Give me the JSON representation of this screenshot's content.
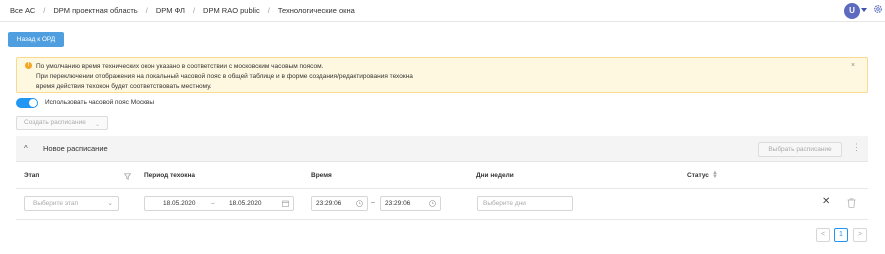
{
  "breadcrumb": {
    "items": [
      "Все АС",
      "DPM проектная область",
      "DPM ФЛ",
      "DPM RAO public",
      "Технологические окна"
    ],
    "separator": "/"
  },
  "user": {
    "avatar_letter": "U"
  },
  "back_button": {
    "label": "Назад к ОРД"
  },
  "alert": {
    "line1": "По умолчанию время технических окон указано в соответствии с московским часовым поясом.",
    "line2": "При переключении отображения на локальный часовой пояс в общей таблице и в форме создания/редактирования техокна",
    "line3": "время действия техокон будет соответствовать местному.",
    "close": "×"
  },
  "timezone_toggle": {
    "label": "Использовать часовой пояс Москвы",
    "enabled": true
  },
  "create_schedule": {
    "label": "Создать расписание"
  },
  "panel": {
    "title": "Новое расписание",
    "choose_button": "Выбрать расписание"
  },
  "table": {
    "headers": {
      "stage": "Этап",
      "period": "Период техокна",
      "time": "Время",
      "weekdays": "Дни недели",
      "status": "Статус"
    },
    "row": {
      "stage_placeholder": "Выберите этап",
      "date_from": "18.05.2020",
      "date_to": "18.05.2020",
      "time_from": "23:29:06",
      "time_to": "23:29:06",
      "weekdays_placeholder": "Выберите дни"
    }
  },
  "pagination": {
    "prev": "<",
    "current": "1",
    "next": ">"
  },
  "colors": {
    "primary": "#2196f3",
    "button": "#4f9fe0",
    "alert_bg": "#fff8e1",
    "alert_icon": "#f5a623",
    "avatar": "#5c6bc0"
  }
}
